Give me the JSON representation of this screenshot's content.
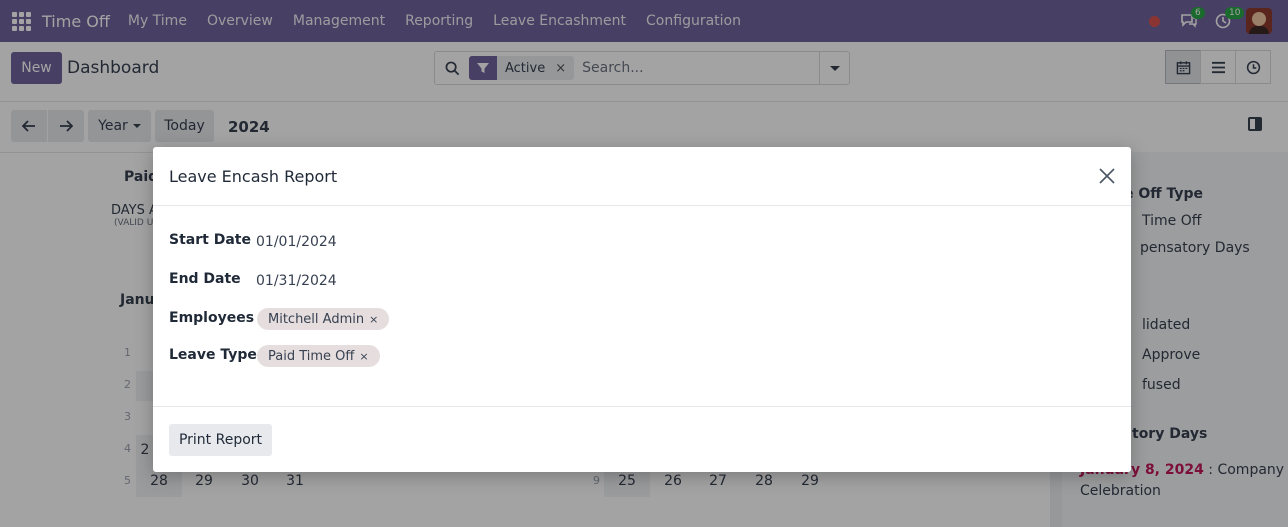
{
  "navbar": {
    "app_title": "Time Off",
    "menu": [
      "My Time",
      "Overview",
      "Management",
      "Reporting",
      "Leave Encashment",
      "Configuration"
    ],
    "chat_badge": "6",
    "activity_badge": "10"
  },
  "control_panel": {
    "new_label": "New",
    "title": "Dashboard",
    "facet_label": "Active",
    "facet_remove": "×",
    "search_placeholder": "Search..."
  },
  "calendar_toolbar": {
    "scale_label": "Year",
    "today_label": "Today",
    "year": "2024"
  },
  "background_calendar": {
    "summary_title": "Paid",
    "summary_days": "DAYS A",
    "summary_valid": "(VALID U",
    "month_title": "Janua",
    "week_numbers": [
      "1",
      "2",
      "3",
      "4",
      "5"
    ],
    "week_numbers_second": [
      "9"
    ],
    "days_row_first": [
      "28",
      "29",
      "30",
      "31"
    ],
    "days_row_second": [
      "25",
      "26",
      "27",
      "28",
      "29"
    ],
    "partial_days": [
      "2"
    ]
  },
  "side_panel": {
    "section1_title": "e Off Type",
    "type_items": [
      "Time Off",
      "pensatory Days"
    ],
    "status_items": [
      "lidated",
      "Approve",
      "fused"
    ],
    "section3_title": "tory Days",
    "event_date": "January 8, 2024",
    "event_text": " : Company",
    "event_text_cont": "Celebration"
  },
  "modal": {
    "title": "Leave Encash Report",
    "fields": {
      "start_date_label": "Start Date",
      "start_date_value": "01/01/2024",
      "end_date_label": "End Date",
      "end_date_value": "01/31/2024",
      "employees_label": "Employees",
      "employee_tag": "Mitchell Admin",
      "leave_type_label": "Leave Type",
      "leave_type_tag": "Paid Time Off",
      "tag_remove": "×"
    },
    "print_button": "Print Report"
  },
  "colors": {
    "brand": "#71639e",
    "tag_bg": "#e6dede",
    "badge_green": "#28a745",
    "event_date": "#c2185b"
  }
}
